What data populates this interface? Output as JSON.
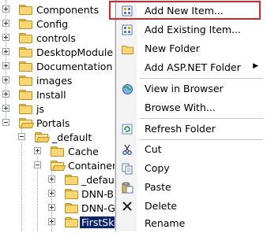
{
  "tree": {
    "items": [
      {
        "label": "Components"
      },
      {
        "label": "Config"
      },
      {
        "label": "controls"
      },
      {
        "label": "DesktopModule"
      },
      {
        "label": "Documentation"
      },
      {
        "label": "images"
      },
      {
        "label": "Install"
      },
      {
        "label": "js"
      },
      {
        "label": "Portals"
      },
      {
        "label": "_default"
      },
      {
        "label": "Cache"
      },
      {
        "label": "Container"
      },
      {
        "label": "_defau"
      },
      {
        "label": "DNN-B"
      },
      {
        "label": "DNN-G"
      },
      {
        "label": "FirstSk"
      }
    ]
  },
  "menu": {
    "items": [
      {
        "label": "Add New Item...",
        "icon": "add-new-item-icon"
      },
      {
        "label": "Add Existing Item...",
        "icon": "add-existing-item-icon"
      },
      {
        "label": "New Folder",
        "icon": "new-folder-icon"
      },
      {
        "label": "Add ASP.NET Folder",
        "icon": "",
        "submenu": true
      },
      {
        "label": "View in Browser",
        "icon": "browser-icon"
      },
      {
        "label": "Browse With...",
        "icon": ""
      },
      {
        "label": "Refresh Folder",
        "icon": "refresh-icon"
      },
      {
        "label": "Cut",
        "icon": "cut-icon"
      },
      {
        "label": "Copy",
        "icon": "copy-icon"
      },
      {
        "label": "Paste",
        "icon": "paste-icon"
      },
      {
        "label": "Delete",
        "icon": "delete-icon"
      },
      {
        "label": "Rename",
        "icon": ""
      }
    ],
    "highlight_color": "#d8242d"
  }
}
